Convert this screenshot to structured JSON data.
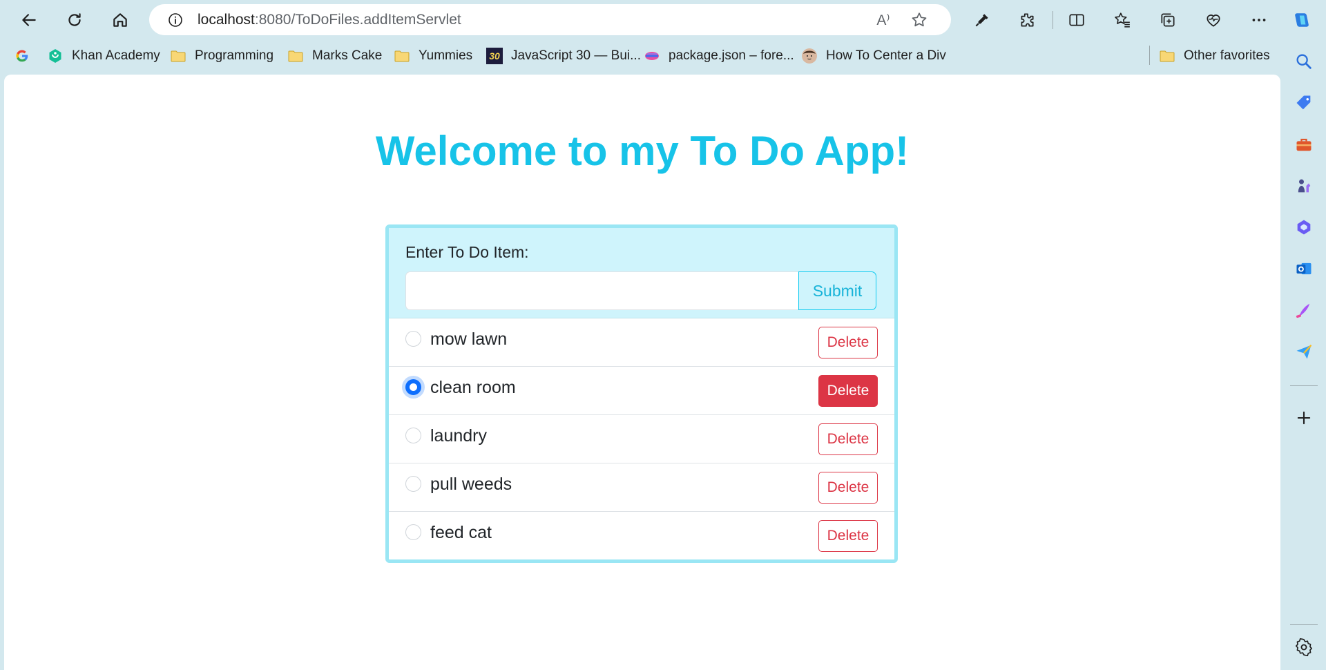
{
  "browser": {
    "url_host": "localhost",
    "url_path": ":8080/ToDoFiles.addItemServlet",
    "read_aloud_label": "A⁾"
  },
  "bookmarks": [
    {
      "label": "",
      "icon": "google-icon"
    },
    {
      "label": "Khan Academy",
      "icon": "khan-academy-icon"
    },
    {
      "label": "Programming",
      "icon": "folder-icon"
    },
    {
      "label": "Marks Cake",
      "icon": "folder-icon"
    },
    {
      "label": "Yummies",
      "icon": "folder-icon"
    },
    {
      "label": "JavaScript 30 — Bui...",
      "icon": "javascript30-icon",
      "icon_text": "30"
    },
    {
      "label": "package.json – fore...",
      "icon": "package-json-icon"
    },
    {
      "label": "How To Center a Div",
      "icon": "avatar-icon"
    },
    {
      "label": "Other favorites",
      "icon": "folder-icon"
    }
  ],
  "page": {
    "title": "Welcome to my To Do App!",
    "form": {
      "label": "Enter To Do Item:",
      "input_value": "",
      "submit_label": "Submit"
    },
    "items": [
      {
        "text": "mow lawn",
        "checked": false,
        "delete_label": "Delete"
      },
      {
        "text": "clean room",
        "checked": true,
        "delete_label": "Delete"
      },
      {
        "text": "laundry",
        "checked": false,
        "delete_label": "Delete"
      },
      {
        "text": "pull weeds",
        "checked": false,
        "delete_label": "Delete"
      },
      {
        "text": "feed cat",
        "checked": false,
        "delete_label": "Delete"
      }
    ]
  },
  "colors": {
    "title": "#17c3e8",
    "card_border": "#9ae6f4",
    "card_header": "#cff4fc",
    "danger": "#dc3545",
    "radio_checked": "#0d6efd"
  }
}
